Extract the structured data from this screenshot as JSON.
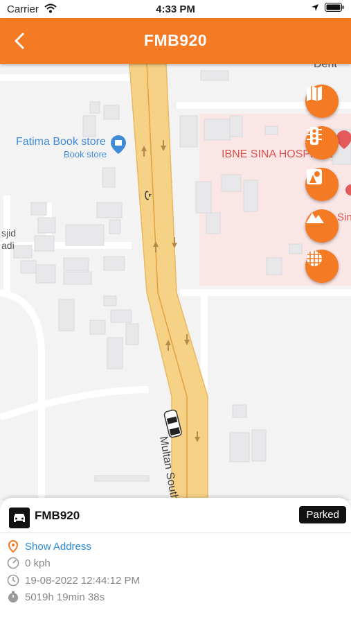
{
  "status_bar": {
    "carrier": "Carrier",
    "time": "4:33 PM"
  },
  "header": {
    "title": "FMB920",
    "back_icon": "chevron-left-icon"
  },
  "map": {
    "labels": {
      "bookstore_name": "Fatima Book store",
      "bookstore_type": "Book store",
      "hospital": "IBNE SINA HOSPITAL",
      "road": "Multan South",
      "road_urdu": "ٹ",
      "masjid_1": "sjid",
      "masjid_2": "adi",
      "top_right": "Dent",
      "sin": "Sin"
    },
    "buttons": [
      {
        "name": "map-type-button",
        "icon": "map-icon"
      },
      {
        "name": "traffic-button",
        "icon": "traffic-light-icon"
      },
      {
        "name": "shapes-button",
        "icon": "shapes-icon"
      },
      {
        "name": "terrain-button",
        "icon": "terrain-icon"
      },
      {
        "name": "grid-button",
        "icon": "grid-icon"
      }
    ]
  },
  "vehicle": {
    "plate": "FMB920",
    "status": "Parked",
    "show_address": "Show Address",
    "speed": "0 kph",
    "timestamp": "19-08-2022 12:44:12 PM",
    "duration": "5019h 19min 38s"
  },
  "colors": {
    "accent": "#f47a24",
    "road": "#f6d286",
    "hospital_zone": "#fbe6e6",
    "link": "#2b8ad6"
  }
}
